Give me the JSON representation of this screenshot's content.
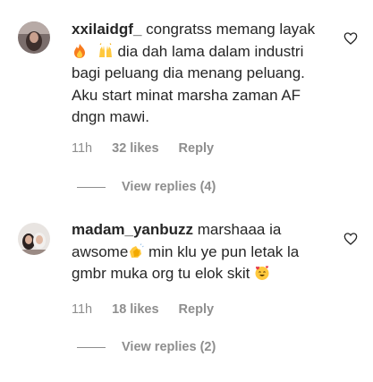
{
  "comments": [
    {
      "username": "xxilaidgf_",
      "text_1": " congratss memang layak",
      "emoji_1": "fire",
      "emoji_2": "raising-hands",
      "text_2": " dia dah lama dalam industri bagi peluang dia menang peluang. Aku start minat marsha zaman AF dngn mawi.",
      "time": "11h",
      "likes": "32 likes",
      "reply": "Reply",
      "view_replies": "View replies (4)"
    },
    {
      "username": "madam_yanbuzz",
      "text_1": " marshaaa ia awsome",
      "emoji_1": "clapping-hands",
      "text_2": " min klu ye pun letak la gmbr muka org tu elok skit ",
      "emoji_2": "smiling-face-with-hearts",
      "time": "11h",
      "likes": "18 likes",
      "reply": "Reply",
      "view_replies": "View replies (2)"
    }
  ],
  "colors": {
    "text": "#262626",
    "secondary": "#8e8e8e",
    "background": "#ffffff"
  }
}
